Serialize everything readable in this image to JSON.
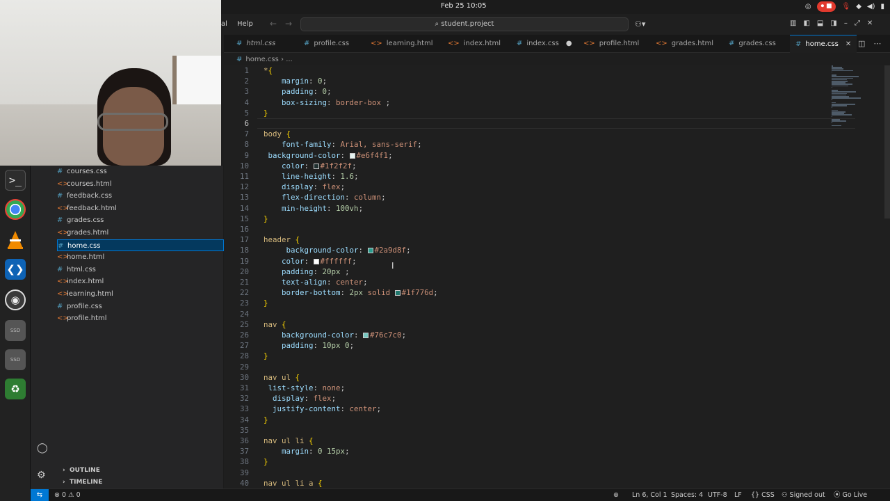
{
  "system": {
    "clock": "Feb 25  10:05",
    "record_label": "⏺ ■"
  },
  "titlebar": {
    "menu_partial": "al",
    "menu_help": "Help",
    "search_text": "student.project"
  },
  "tabs": [
    {
      "label": "html.css",
      "icon": "css",
      "italic": true
    },
    {
      "label": "profile.css",
      "icon": "css"
    },
    {
      "label": "learning.html",
      "icon": "html"
    },
    {
      "label": "index.html",
      "icon": "html"
    },
    {
      "label": "index.css",
      "icon": "css",
      "modified": true
    },
    {
      "label": "profile.html",
      "icon": "html"
    },
    {
      "label": "grades.html",
      "icon": "html"
    },
    {
      "label": "grades.css",
      "icon": "css"
    },
    {
      "label": "home.css",
      "icon": "css",
      "active": true
    }
  ],
  "breadcrumb": {
    "file": "home.css",
    "more": "..."
  },
  "explorer": {
    "files": [
      {
        "label": "courses.css",
        "icon": "css"
      },
      {
        "label": "courses.html",
        "icon": "html"
      },
      {
        "label": "feedback.css",
        "icon": "css"
      },
      {
        "label": "feedback.html",
        "icon": "html"
      },
      {
        "label": "grades.css",
        "icon": "css"
      },
      {
        "label": "grades.html",
        "icon": "html"
      },
      {
        "label": "home.css",
        "icon": "css",
        "active": true
      },
      {
        "label": "home.html",
        "icon": "html"
      },
      {
        "label": "html.css",
        "icon": "css"
      },
      {
        "label": "index.html",
        "icon": "html"
      },
      {
        "label": "learning.html",
        "icon": "html"
      },
      {
        "label": "profile.css",
        "icon": "css"
      },
      {
        "label": "profile.html",
        "icon": "html"
      }
    ],
    "outline_label": "OUTLINE",
    "timeline_label": "TIMELINE"
  },
  "editor": {
    "current_line": 6,
    "lines": [
      [
        [
          "sel",
          "*"
        ],
        [
          "brace",
          "{"
        ]
      ],
      [
        [
          "indent",
          "    "
        ],
        [
          "prop",
          "margin"
        ],
        [
          "punc",
          ": "
        ],
        [
          "num",
          "0"
        ],
        [
          "punc",
          ";"
        ]
      ],
      [
        [
          "indent",
          "    "
        ],
        [
          "prop",
          "padding"
        ],
        [
          "punc",
          ": "
        ],
        [
          "num",
          "0"
        ],
        [
          "punc",
          ";"
        ]
      ],
      [
        [
          "indent",
          "    "
        ],
        [
          "prop",
          "box-sizing"
        ],
        [
          "punc",
          ": "
        ],
        [
          "val",
          "border-box"
        ],
        [
          "punc",
          " ;"
        ]
      ],
      [
        [
          "brace",
          "}"
        ]
      ],
      [],
      [
        [
          "sel",
          "body"
        ],
        [
          "punc",
          " "
        ],
        [
          "brace",
          "{"
        ]
      ],
      [
        [
          "indent",
          "    "
        ],
        [
          "prop",
          "font-family"
        ],
        [
          "punc",
          ": "
        ],
        [
          "val",
          "Arial, sans-serif"
        ],
        [
          "punc",
          ";"
        ]
      ],
      [
        [
          "indent",
          " "
        ],
        [
          "prop",
          "background-color"
        ],
        [
          "punc",
          ": "
        ],
        [
          "swatch",
          "#e6f4f1"
        ],
        [
          "val",
          "#e6f4f1"
        ],
        [
          "punc",
          ";"
        ]
      ],
      [
        [
          "indent",
          "    "
        ],
        [
          "prop",
          "color"
        ],
        [
          "punc",
          ": "
        ],
        [
          "swatch",
          "#1f2f2f"
        ],
        [
          "val",
          "#1f2f2f"
        ],
        [
          "punc",
          ";"
        ]
      ],
      [
        [
          "indent",
          "    "
        ],
        [
          "prop",
          "line-height"
        ],
        [
          "punc",
          ": "
        ],
        [
          "num",
          "1.6"
        ],
        [
          "punc",
          ";"
        ]
      ],
      [
        [
          "indent",
          "    "
        ],
        [
          "prop",
          "display"
        ],
        [
          "punc",
          ": "
        ],
        [
          "val",
          "flex"
        ],
        [
          "punc",
          ";"
        ]
      ],
      [
        [
          "indent",
          "    "
        ],
        [
          "prop",
          "flex-direction"
        ],
        [
          "punc",
          ": "
        ],
        [
          "val",
          "column"
        ],
        [
          "punc",
          ";"
        ]
      ],
      [
        [
          "indent",
          "    "
        ],
        [
          "prop",
          "min-height"
        ],
        [
          "punc",
          ": "
        ],
        [
          "num",
          "100vh"
        ],
        [
          "punc",
          ";"
        ]
      ],
      [
        [
          "brace",
          "}"
        ]
      ],
      [],
      [
        [
          "sel",
          "header"
        ],
        [
          "punc",
          " "
        ],
        [
          "brace",
          "{"
        ]
      ],
      [
        [
          "indent",
          "     "
        ],
        [
          "prop",
          "background-color"
        ],
        [
          "punc",
          ": "
        ],
        [
          "swatch",
          "#2a9d8f"
        ],
        [
          "val",
          "#2a9d8f"
        ],
        [
          "punc",
          ";"
        ]
      ],
      [
        [
          "indent",
          "    "
        ],
        [
          "prop",
          "color"
        ],
        [
          "punc",
          ": "
        ],
        [
          "swatch",
          "#ffffff"
        ],
        [
          "val",
          "#ffffff"
        ],
        [
          "punc",
          ";"
        ]
      ],
      [
        [
          "indent",
          "    "
        ],
        [
          "prop",
          "padding"
        ],
        [
          "punc",
          ": "
        ],
        [
          "num",
          "20px"
        ],
        [
          "punc",
          " ;"
        ]
      ],
      [
        [
          "indent",
          "    "
        ],
        [
          "prop",
          "text-align"
        ],
        [
          "punc",
          ": "
        ],
        [
          "val",
          "center"
        ],
        [
          "punc",
          ";"
        ]
      ],
      [
        [
          "indent",
          "    "
        ],
        [
          "prop",
          "border-bottom"
        ],
        [
          "punc",
          ": "
        ],
        [
          "num",
          "2px"
        ],
        [
          "val",
          " solid "
        ],
        [
          "swatch",
          "#1f776d"
        ],
        [
          "val",
          "#1f776d"
        ],
        [
          "punc",
          ";"
        ]
      ],
      [
        [
          "brace",
          "}"
        ]
      ],
      [],
      [
        [
          "sel",
          "nav"
        ],
        [
          "punc",
          " "
        ],
        [
          "brace",
          "{"
        ]
      ],
      [
        [
          "indent",
          "    "
        ],
        [
          "prop",
          "background-color"
        ],
        [
          "punc",
          ": "
        ],
        [
          "swatch",
          "#76c7c0"
        ],
        [
          "val",
          "#76c7c0"
        ],
        [
          "punc",
          ";"
        ]
      ],
      [
        [
          "indent",
          "    "
        ],
        [
          "prop",
          "padding"
        ],
        [
          "punc",
          ": "
        ],
        [
          "num",
          "10px 0"
        ],
        [
          "punc",
          ";"
        ]
      ],
      [
        [
          "brace",
          "}"
        ]
      ],
      [],
      [
        [
          "sel",
          "nav ul"
        ],
        [
          "punc",
          " "
        ],
        [
          "brace",
          "{"
        ]
      ],
      [
        [
          "indent",
          " "
        ],
        [
          "prop",
          "list-style"
        ],
        [
          "punc",
          ": "
        ],
        [
          "val",
          "none"
        ],
        [
          "punc",
          ";"
        ]
      ],
      [
        [
          "indent",
          "  "
        ],
        [
          "prop",
          "display"
        ],
        [
          "punc",
          ": "
        ],
        [
          "val",
          "flex"
        ],
        [
          "punc",
          ";"
        ]
      ],
      [
        [
          "indent",
          "  "
        ],
        [
          "prop",
          "justify-content"
        ],
        [
          "punc",
          ": "
        ],
        [
          "val",
          "center"
        ],
        [
          "punc",
          ";"
        ]
      ],
      [
        [
          "brace",
          "}"
        ]
      ],
      [],
      [
        [
          "sel",
          "nav ul li"
        ],
        [
          "punc",
          " "
        ],
        [
          "brace",
          "{"
        ]
      ],
      [
        [
          "indent",
          "    "
        ],
        [
          "prop",
          "margin"
        ],
        [
          "punc",
          ": "
        ],
        [
          "num",
          "0 15px"
        ],
        [
          "punc",
          ";"
        ]
      ],
      [
        [
          "brace",
          "}"
        ]
      ],
      [],
      [
        [
          "sel",
          "nav ul li a"
        ],
        [
          "punc",
          " "
        ],
        [
          "brace",
          "{"
        ]
      ]
    ]
  },
  "statusbar": {
    "errors": "⊗ 0 ⚠ 0",
    "position": "Ln 6, Col 1",
    "spaces": "Spaces: 4",
    "encoding": "UTF-8",
    "eol": "LF",
    "language": "CSS",
    "account": "Signed out",
    "golive": "Go Live"
  },
  "colors": {
    "accent": "#0078d4",
    "css_icon": "#519aba",
    "html_icon": "#e37933"
  }
}
